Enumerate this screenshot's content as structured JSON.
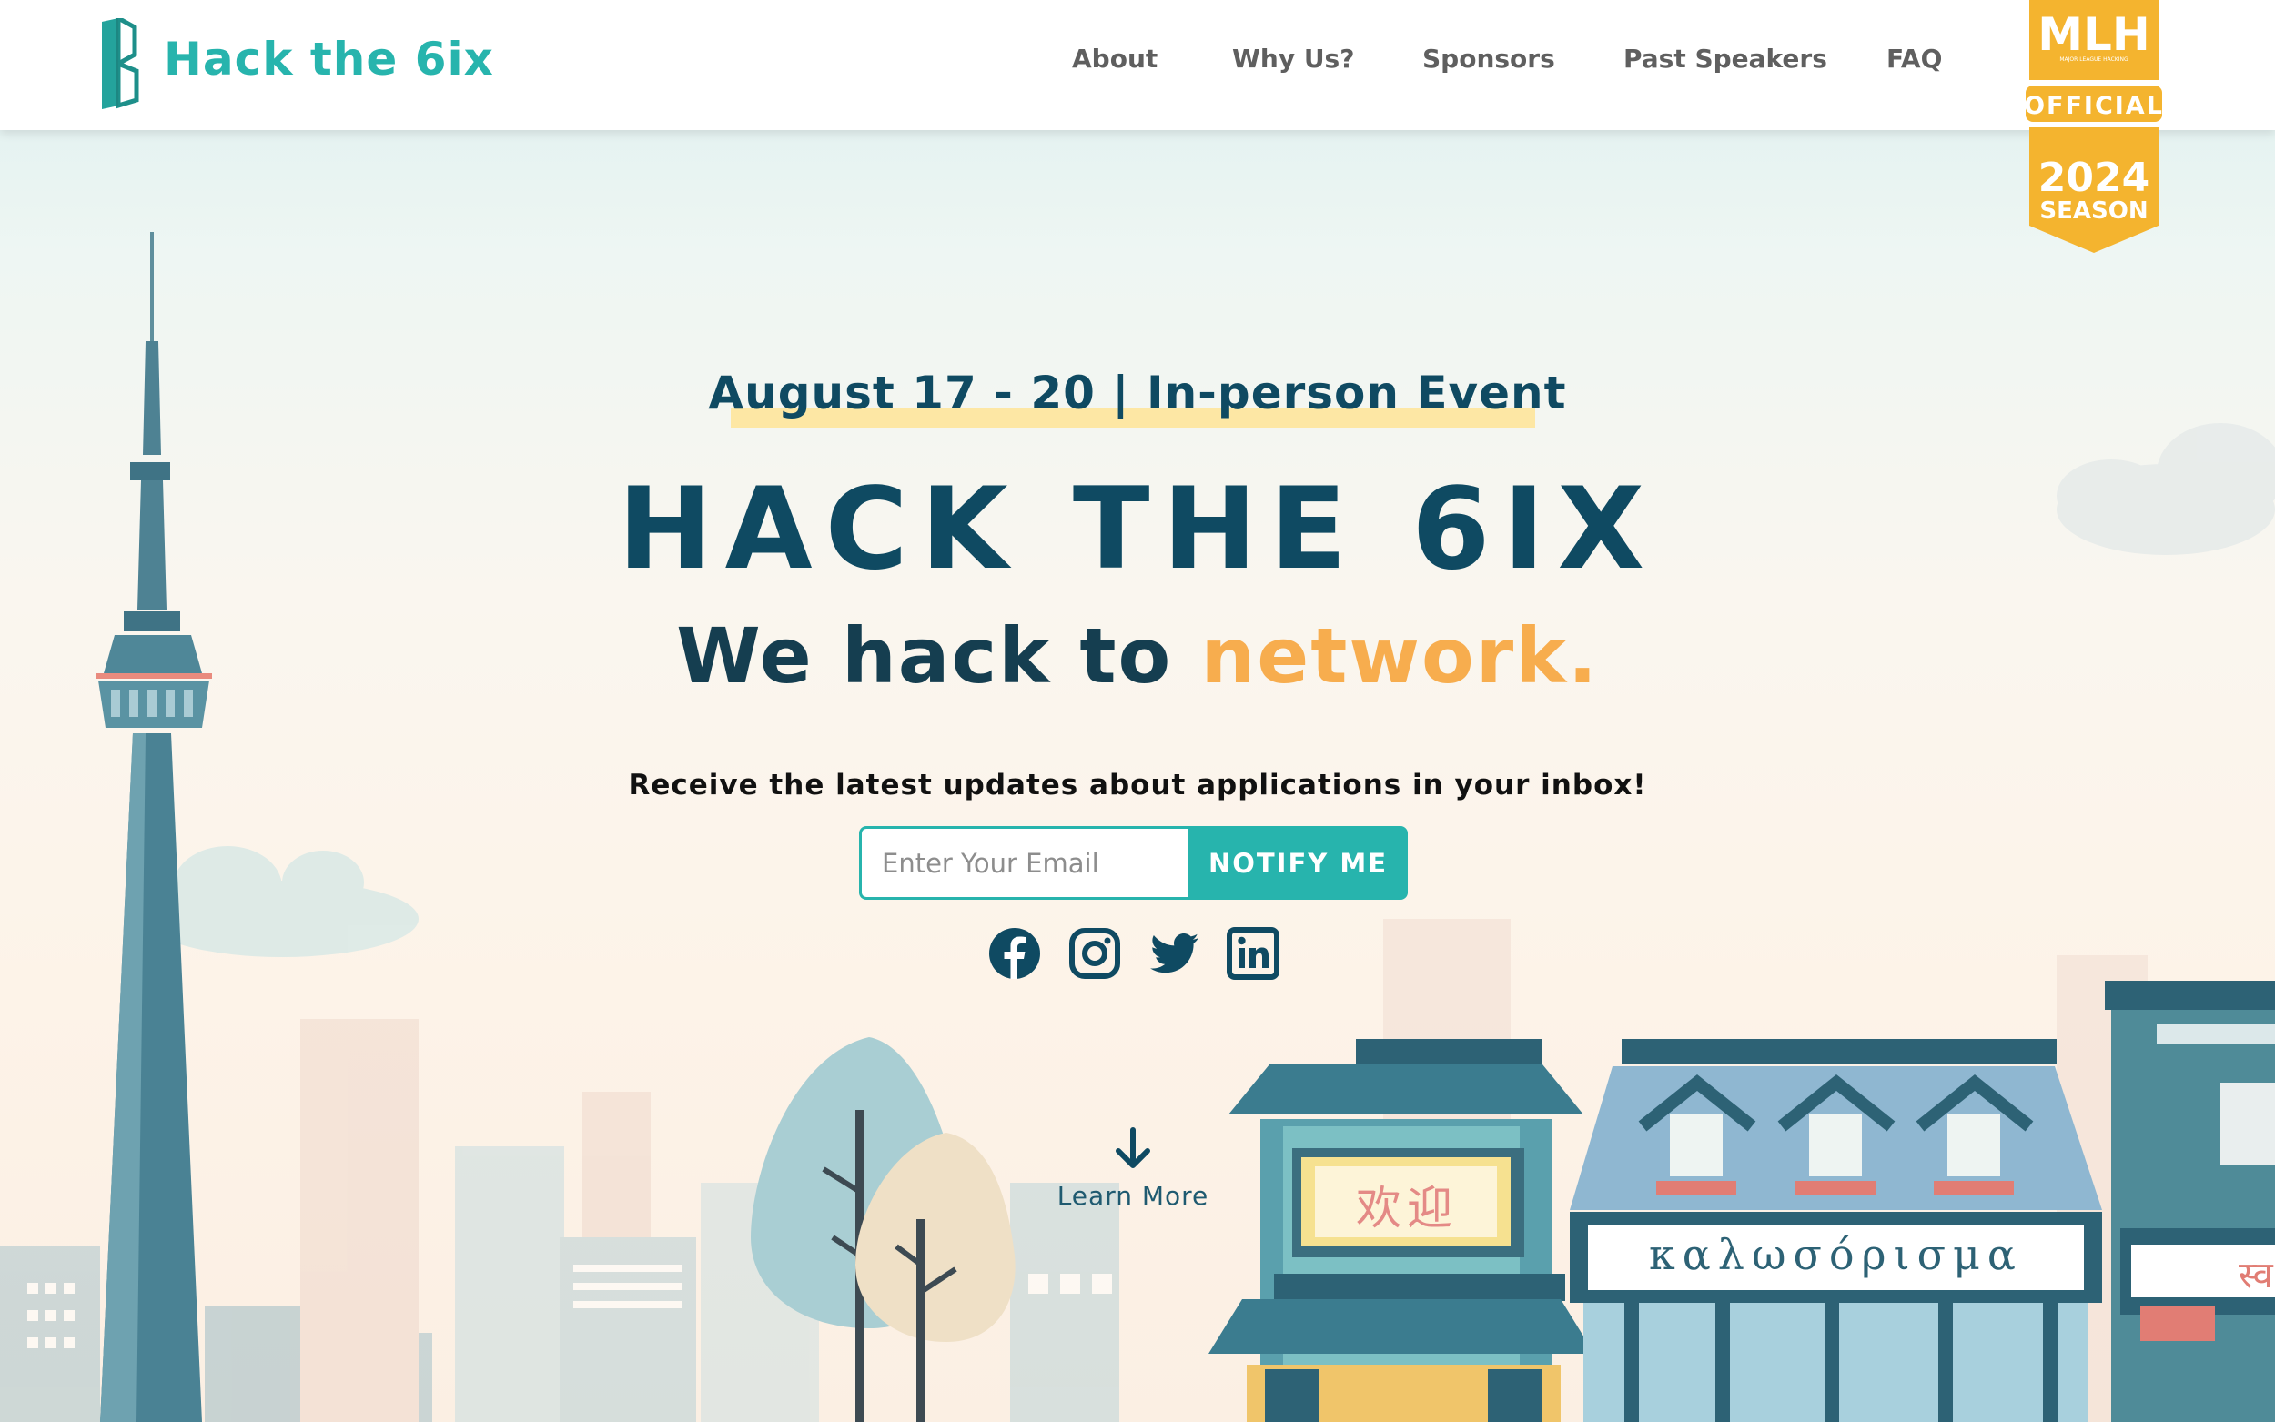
{
  "header": {
    "logo_text": "Hack the 6ix",
    "nav": [
      {
        "label": "About"
      },
      {
        "label": "Why Us?"
      },
      {
        "label": "Sponsors"
      },
      {
        "label": "Past Speakers"
      },
      {
        "label": "FAQ"
      }
    ],
    "mlh_badge": {
      "top": "MLH",
      "sub": "MAJOR LEAGUE HACKING",
      "ribbon": "OFFICIAL",
      "year": "2024",
      "season": "SEASON"
    }
  },
  "hero": {
    "event_date": "August 17 - 20 | In-person Event",
    "title": "HACK THE 6IX",
    "tagline_prefix": "We hack to ",
    "tagline_accent": "network.",
    "updates_text": "Receive the latest updates about applications in your inbox!",
    "email_placeholder": "Enter Your Email",
    "notify_button": "NOTIFY ME",
    "social_icons": [
      "facebook-icon",
      "instagram-icon",
      "twitter-icon",
      "linkedin-icon"
    ],
    "learn_more": "Learn More"
  },
  "scene": {
    "sign_chinese": "欢迎",
    "sign_greek": "καλωσόρισμα",
    "sign_partial": "स्व"
  },
  "colors": {
    "brand_teal": "#27b4ad",
    "navy": "#0f4a62",
    "accent_orange": "#f7ad4e",
    "badge_gold": "#f4b42f"
  }
}
